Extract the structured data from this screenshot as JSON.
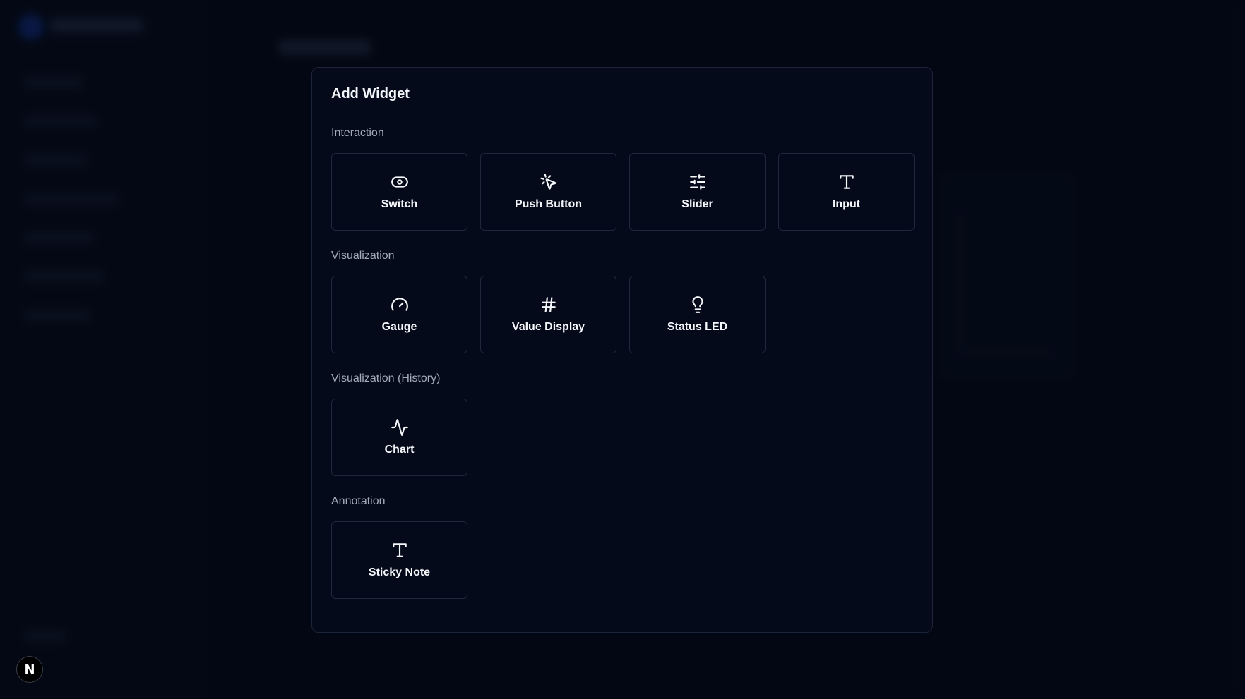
{
  "modal": {
    "title": "Add Widget",
    "sections": [
      {
        "label": "Interaction",
        "tiles": [
          {
            "label": "Switch",
            "icon": "toggle-icon"
          },
          {
            "label": "Push Button",
            "icon": "pointer-click-icon"
          },
          {
            "label": "Slider",
            "icon": "sliders-icon"
          },
          {
            "label": "Input",
            "icon": "text-icon"
          }
        ]
      },
      {
        "label": "Visualization",
        "tiles": [
          {
            "label": "Gauge",
            "icon": "gauge-icon"
          },
          {
            "label": "Value Display",
            "icon": "hash-icon"
          },
          {
            "label": "Status LED",
            "icon": "lightbulb-icon"
          }
        ]
      },
      {
        "label": "Visualization (History)",
        "tiles": [
          {
            "label": "Chart",
            "icon": "activity-icon"
          }
        ]
      },
      {
        "label": "Annotation",
        "tiles": [
          {
            "label": "Sticky Note",
            "icon": "text-icon"
          }
        ]
      }
    ]
  },
  "badge": {
    "letter": "N"
  },
  "colors": {
    "background": "#060b1a",
    "modal_background": "#050a1a",
    "tile_border": "#1f283b",
    "section_label": "#a3aab8",
    "text": "#f4f6fa"
  }
}
